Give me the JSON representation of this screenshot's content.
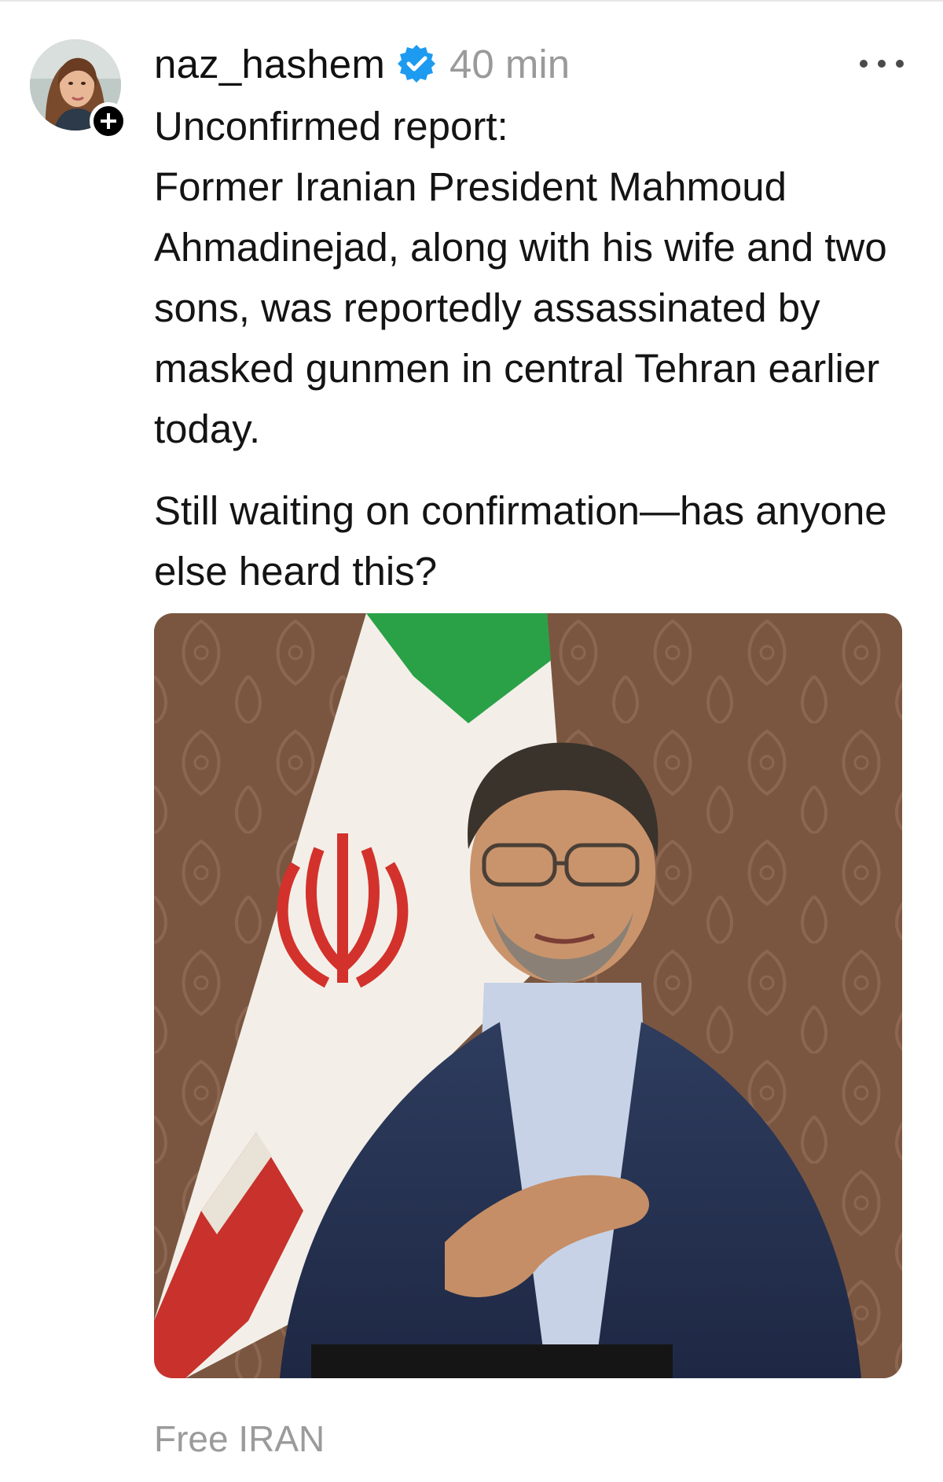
{
  "post": {
    "username": "naz_hashem",
    "verified": true,
    "timestamp": "40 min",
    "paragraphs": [
      "Unconfirmed report:\nFormer Iranian President Mahmoud Ahmadinejad, along with his wife and two sons, was reportedly assassinated by masked gunmen in central Tehran earlier today.",
      "Still waiting on confirmation—has anyone else heard this?"
    ],
    "tag": "Free IRAN"
  },
  "icons": {
    "verified": "verified-badge-icon",
    "follow": "plus-icon",
    "more": "more-options-icon"
  },
  "colors": {
    "verified_blue": "#1d9bf0",
    "timestamp_gray": "#9a9a9a",
    "tag_gray": "#9b9b9b",
    "flag_green": "#239f40",
    "flag_red": "#da0000"
  }
}
